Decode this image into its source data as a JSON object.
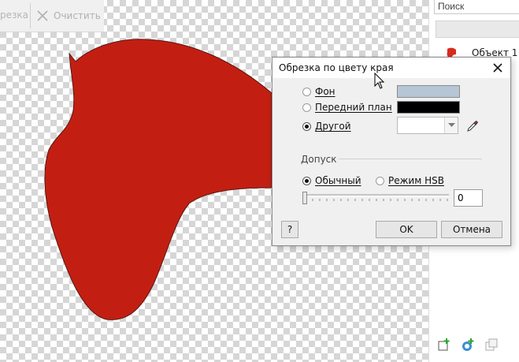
{
  "toolbar": {
    "crop_label": "резка",
    "clear_label": "Очистить",
    "clear_icon": "close-icon"
  },
  "canvas": {
    "shape_color": "#c21f12",
    "checker_color": "#d6d6d6"
  },
  "panel": {
    "search_placeholder": "Поиск",
    "layer_name": "Объект 1",
    "layer_thumb_color": "#d92b1f",
    "bottom_icons": [
      "new-object-icon",
      "add-mask-icon",
      "duplicate-icon"
    ]
  },
  "dialog": {
    "title": "Обрезка по цвету края",
    "options": {
      "background_label": "Фон",
      "foreground_label": "Передний план",
      "other_label": "Другой",
      "selected": "other"
    },
    "colors": {
      "background": "#b7c6d6",
      "foreground": "#000000",
      "other": "#ffffff"
    },
    "tolerance": {
      "label": "Допуск",
      "normal_label": "Обычный",
      "hsb_label": "Режим HSB",
      "mode": "normal",
      "value": "0"
    },
    "buttons": {
      "help": "?",
      "ok": "OK",
      "cancel": "Отмена"
    }
  }
}
